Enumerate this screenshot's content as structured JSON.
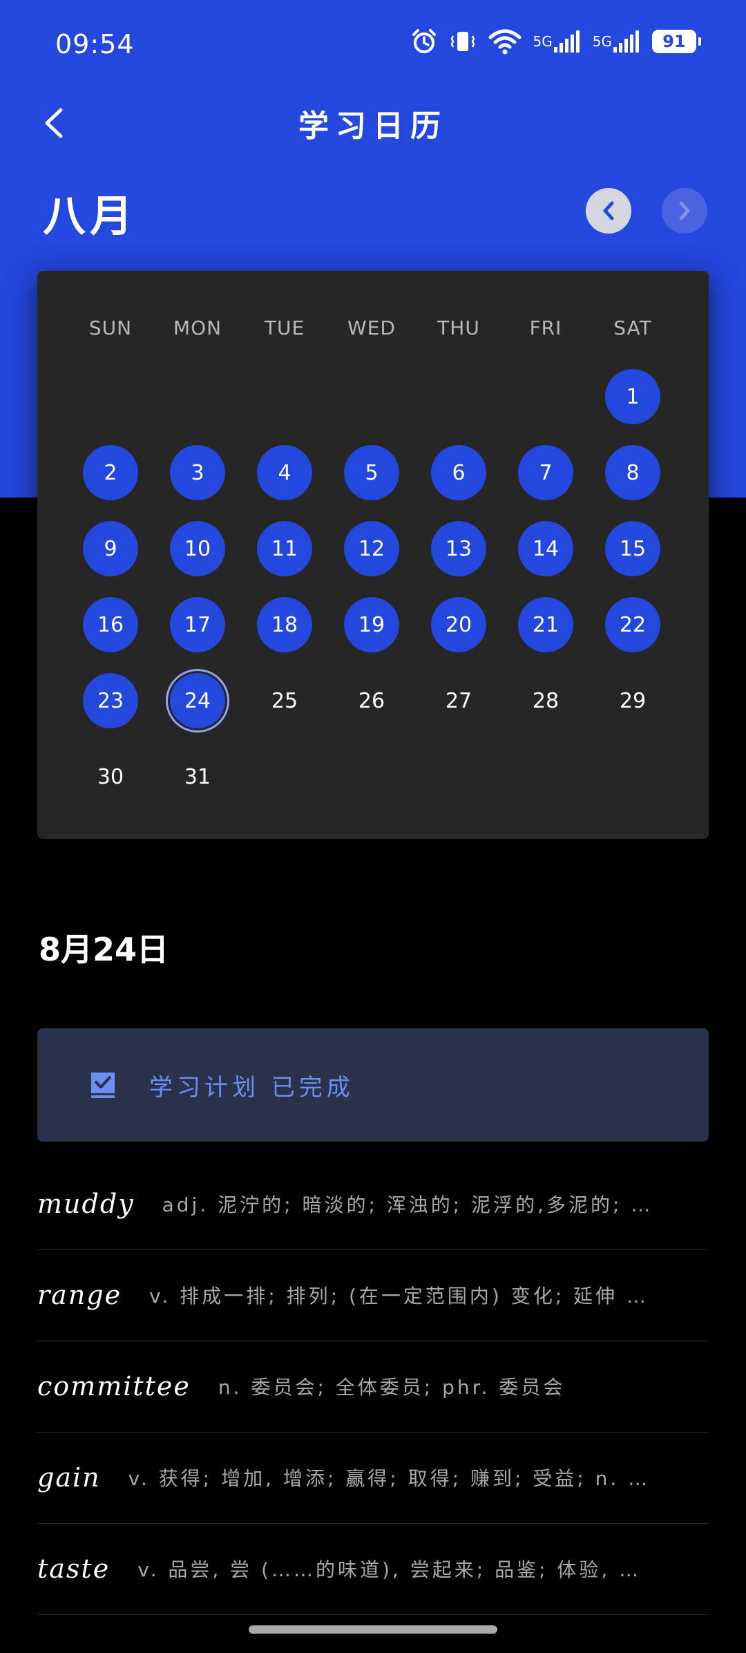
{
  "status_bar": {
    "time": "09:54",
    "network_1": "5G",
    "network_2": "5G",
    "battery": "91",
    "icons": [
      "alarm-icon",
      "vibrate-icon",
      "wifi-icon",
      "signal-icon",
      "signal-icon",
      "battery-icon"
    ]
  },
  "header": {
    "title": "学习日历",
    "back_icon": "chevron-left-icon"
  },
  "calendar": {
    "month": "八月",
    "prev_icon": "chevron-left-icon",
    "next_icon": "chevron-right-icon",
    "weekdays": [
      "SUN",
      "MON",
      "TUE",
      "WED",
      "THU",
      "FRI",
      "SAT"
    ],
    "first_weekday_index": 6,
    "days_in_month": 31,
    "completed_through": 24,
    "today": 24,
    "completed_color": "#2447dd",
    "days": [
      "1",
      "2",
      "3",
      "4",
      "5",
      "6",
      "7",
      "8",
      "9",
      "10",
      "11",
      "12",
      "13",
      "14",
      "15",
      "16",
      "17",
      "18",
      "19",
      "20",
      "21",
      "22",
      "23",
      "24",
      "25",
      "26",
      "27",
      "28",
      "29",
      "30",
      "31"
    ]
  },
  "selected_date": "8月24日",
  "plan": {
    "icon": "checkbox-checked-icon",
    "text": "学习计划 已完成"
  },
  "words": [
    {
      "word": "muddy",
      "definition": "adj. 泥泞的; 暗淡的; 浑浊的; 泥浮的,多泥的; …"
    },
    {
      "word": "range",
      "definition": "v. 排成一排; 排列; (在一定范围内) 变化; 延伸 …"
    },
    {
      "word": "committee",
      "definition": "n. 委员会; 全体委员; phr. 委员会"
    },
    {
      "word": "gain",
      "definition": "v. 获得; 增加, 增添; 赢得; 取得; 赚到; 受益; n. …"
    },
    {
      "word": "taste",
      "definition": "v. 品尝, 尝 (……的味道), 尝起来; 品鉴; 体验, …"
    }
  ]
}
